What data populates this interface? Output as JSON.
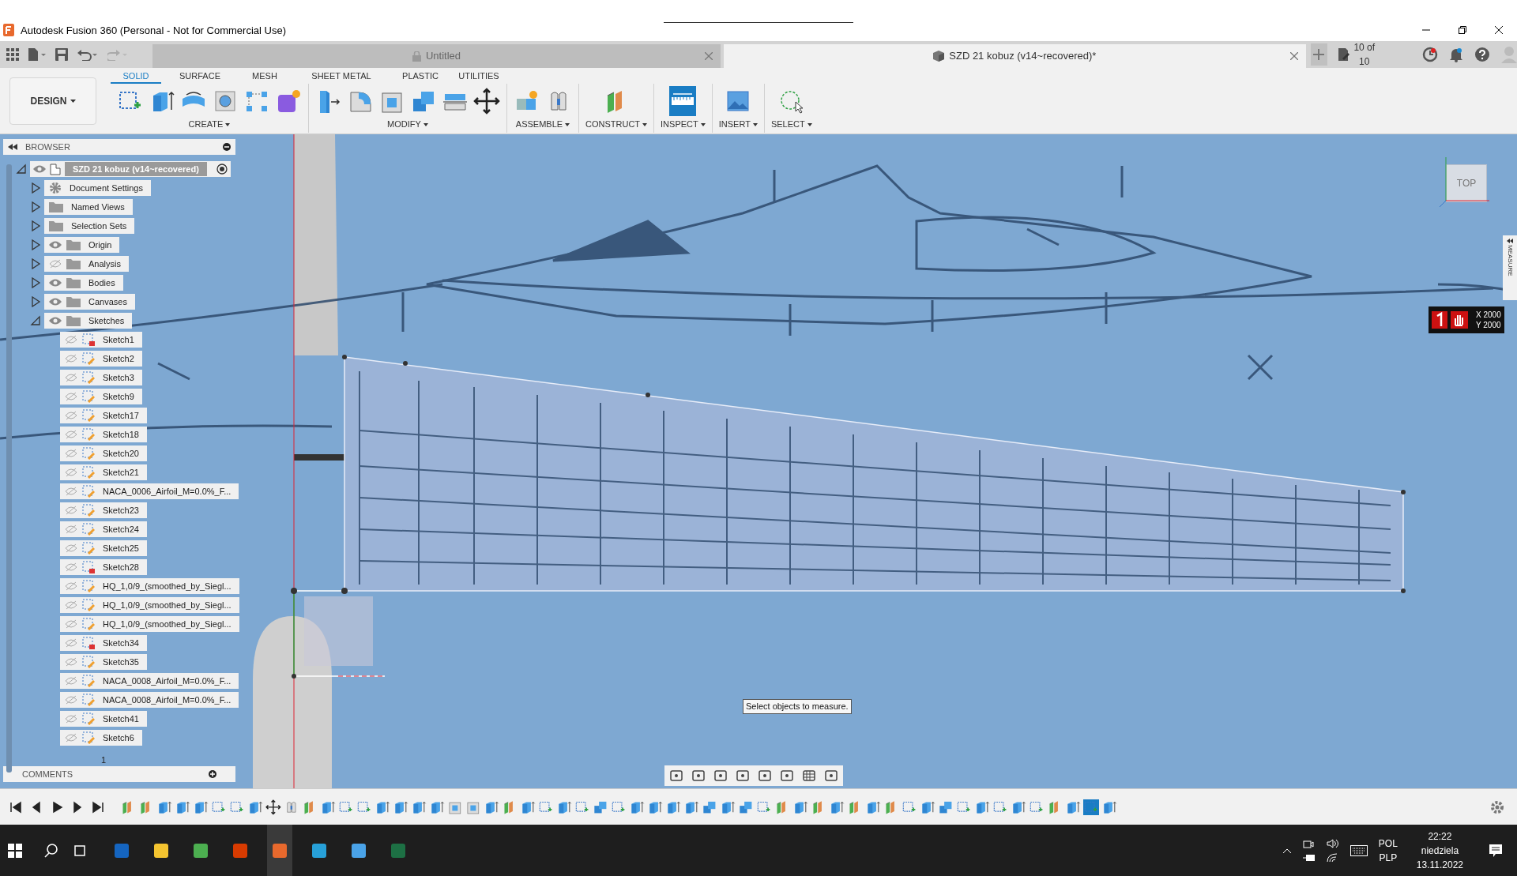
{
  "window": {
    "title": "Autodesk Fusion 360 (Personal - Not for Commercial Use)"
  },
  "doc_tabs": [
    {
      "label": "Untitled",
      "selected": false
    },
    {
      "label": "SZD 21 kobuz (v14~recovered)*",
      "selected": true
    }
  ],
  "job_status": "10 of 10",
  "workspace": "DESIGN",
  "toolbar_tabs": [
    {
      "label": "SOLID",
      "selected": true
    },
    {
      "label": "SURFACE",
      "selected": false
    },
    {
      "label": "MESH",
      "selected": false
    },
    {
      "label": "SHEET METAL",
      "selected": false
    },
    {
      "label": "PLASTIC",
      "selected": false
    },
    {
      "label": "UTILITIES",
      "selected": false
    }
  ],
  "toolbar_groups": [
    {
      "label": "CREATE",
      "active": false
    },
    {
      "label": "MODIFY",
      "active": false
    },
    {
      "label": "ASSEMBLE",
      "active": false
    },
    {
      "label": "CONSTRUCT",
      "active": false
    },
    {
      "label": "INSPECT",
      "active": true
    },
    {
      "label": "INSERT",
      "active": false
    },
    {
      "label": "SELECT",
      "active": false
    }
  ],
  "browser": {
    "title": "BROWSER",
    "tree": [
      {
        "label": "SZD 21 kobuz (v14~recovered)",
        "kind": "root",
        "expanded": true,
        "visible": true,
        "children": [
          {
            "label": "Document Settings",
            "kind": "settings",
            "expanded": false
          },
          {
            "label": "Named Views",
            "kind": "folder",
            "expanded": false
          },
          {
            "label": "Selection Sets",
            "kind": "folder",
            "expanded": false
          },
          {
            "label": "Origin",
            "kind": "folder",
            "expanded": false,
            "visible": true
          },
          {
            "label": "Analysis",
            "kind": "folder",
            "expanded": false,
            "visible": false
          },
          {
            "label": "Bodies",
            "kind": "folder",
            "expanded": false,
            "visible": true
          },
          {
            "label": "Canvases",
            "kind": "folder",
            "expanded": false,
            "visible": true
          },
          {
            "label": "Sketches",
            "kind": "folder",
            "expanded": true,
            "visible": true,
            "children": [
              {
                "label": "Sketch1",
                "kind": "sketch",
                "visible": false,
                "locked": true
              },
              {
                "label": "Sketch2",
                "kind": "sketch",
                "visible": false,
                "locked": false
              },
              {
                "label": "Sketch3",
                "kind": "sketch",
                "visible": false,
                "locked": false
              },
              {
                "label": "Sketch9",
                "kind": "sketch",
                "visible": false,
                "locked": false
              },
              {
                "label": "Sketch17",
                "kind": "sketch",
                "visible": false,
                "locked": false
              },
              {
                "label": "Sketch18",
                "kind": "sketch",
                "visible": false,
                "locked": false
              },
              {
                "label": "Sketch20",
                "kind": "sketch",
                "visible": false,
                "locked": false
              },
              {
                "label": "Sketch21",
                "kind": "sketch",
                "visible": false,
                "locked": false
              },
              {
                "label": "NACA_0006_Airfoil_M=0.0%_F...",
                "kind": "sketch",
                "visible": false,
                "locked": false
              },
              {
                "label": "Sketch23",
                "kind": "sketch",
                "visible": false,
                "locked": false
              },
              {
                "label": "Sketch24",
                "kind": "sketch",
                "visible": false,
                "locked": false
              },
              {
                "label": "Sketch25",
                "kind": "sketch",
                "visible": false,
                "locked": false
              },
              {
                "label": "Sketch28",
                "kind": "sketch",
                "visible": false,
                "locked": true
              },
              {
                "label": "HQ_1,0/9_(smoothed_by_Siegl...",
                "kind": "sketch",
                "visible": false,
                "locked": false
              },
              {
                "label": "HQ_1,0/9_(smoothed_by_Siegl...",
                "kind": "sketch",
                "visible": false,
                "locked": false
              },
              {
                "label": "HQ_1,0/9_(smoothed_by_Siegl...",
                "kind": "sketch",
                "visible": false,
                "locked": false
              },
              {
                "label": "Sketch34",
                "kind": "sketch",
                "visible": false,
                "locked": true
              },
              {
                "label": "Sketch35",
                "kind": "sketch",
                "visible": false,
                "locked": false
              },
              {
                "label": "NACA_0008_Airfoil_M=0.0%_F...",
                "kind": "sketch",
                "visible": false,
                "locked": false
              },
              {
                "label": "NACA_0008_Airfoil_M=0.0%_F...",
                "kind": "sketch",
                "visible": false,
                "locked": false
              },
              {
                "label": "Sketch41",
                "kind": "sketch",
                "visible": false,
                "locked": false
              },
              {
                "label": "Sketch6",
                "kind": "sketch",
                "visible": false,
                "locked": false
              }
            ]
          }
        ]
      }
    ]
  },
  "marker_count": "1",
  "comments": {
    "title": "COMMENTS"
  },
  "tooltip": "Select objects to measure.",
  "view_cube": "TOP",
  "side_tab": "MEASURE",
  "coordinates": [
    "X 2000",
    "Y 2000"
  ],
  "taskbar": {
    "language": [
      "POL",
      "PLP"
    ],
    "time": "22:22",
    "day": "niedziela",
    "date": "13.11.2022"
  }
}
